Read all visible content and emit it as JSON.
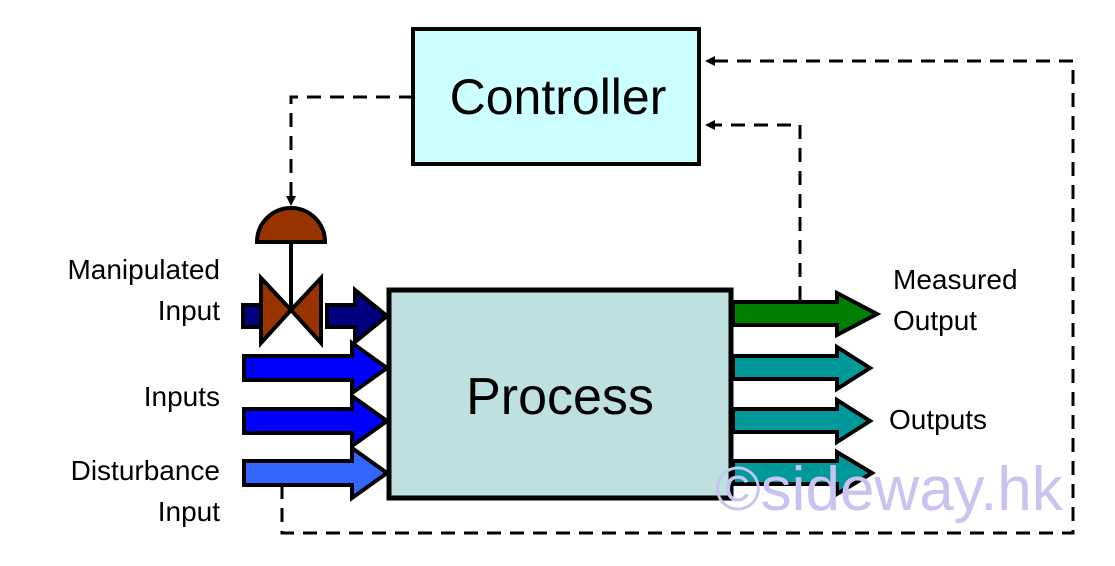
{
  "controller": {
    "label": "Controller",
    "fill": "#ccffff"
  },
  "process": {
    "label": "Process",
    "fill": "#bfe0e0"
  },
  "labels": {
    "manipulated_input": [
      "Manipulated",
      "Input"
    ],
    "inputs": "Inputs",
    "disturbance_input": [
      "Disturbance",
      "Input"
    ],
    "measured_output": [
      "Measured",
      "Output"
    ],
    "outputs": "Outputs"
  },
  "colors": {
    "manipulated": "#000080",
    "input": "#0000ff",
    "disturbance": "#3366ff",
    "measured": "#008000",
    "output": "#009999",
    "valve": "#993300"
  },
  "watermark": "©sideway.hk"
}
